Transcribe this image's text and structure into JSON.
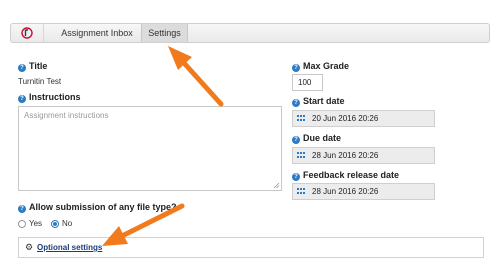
{
  "tabs": [
    {
      "label": "Assignment Inbox",
      "active": false
    },
    {
      "label": "Settings",
      "active": true
    }
  ],
  "title": {
    "label": "Title",
    "value": "Turnitin Test"
  },
  "instructions": {
    "label": "Instructions",
    "placeholder": "Assignment instructions"
  },
  "max_grade": {
    "label": "Max Grade",
    "value": "100"
  },
  "start_date": {
    "label": "Start date",
    "value": "20 Jun 2016 20:26"
  },
  "due_date": {
    "label": "Due date",
    "value": "28 Jun 2016 20:26"
  },
  "feedback_date": {
    "label": "Feedback release date",
    "value": "28 Jun 2016 20:26"
  },
  "file_type": {
    "label": "Allow submission of any file type?",
    "options": [
      {
        "label": "Yes",
        "selected": false
      },
      {
        "label": "No",
        "selected": true
      }
    ]
  },
  "optional_settings": {
    "label": "Optional settings"
  },
  "colors": {
    "accent": "#2d7bc4",
    "arrow": "#f07a1c",
    "link": "#1a3c78"
  },
  "icons": {
    "help": "question-circle-icon",
    "calendar": "calendar-icon",
    "settings": "gear-icon",
    "logo": "turnitin-logo"
  }
}
